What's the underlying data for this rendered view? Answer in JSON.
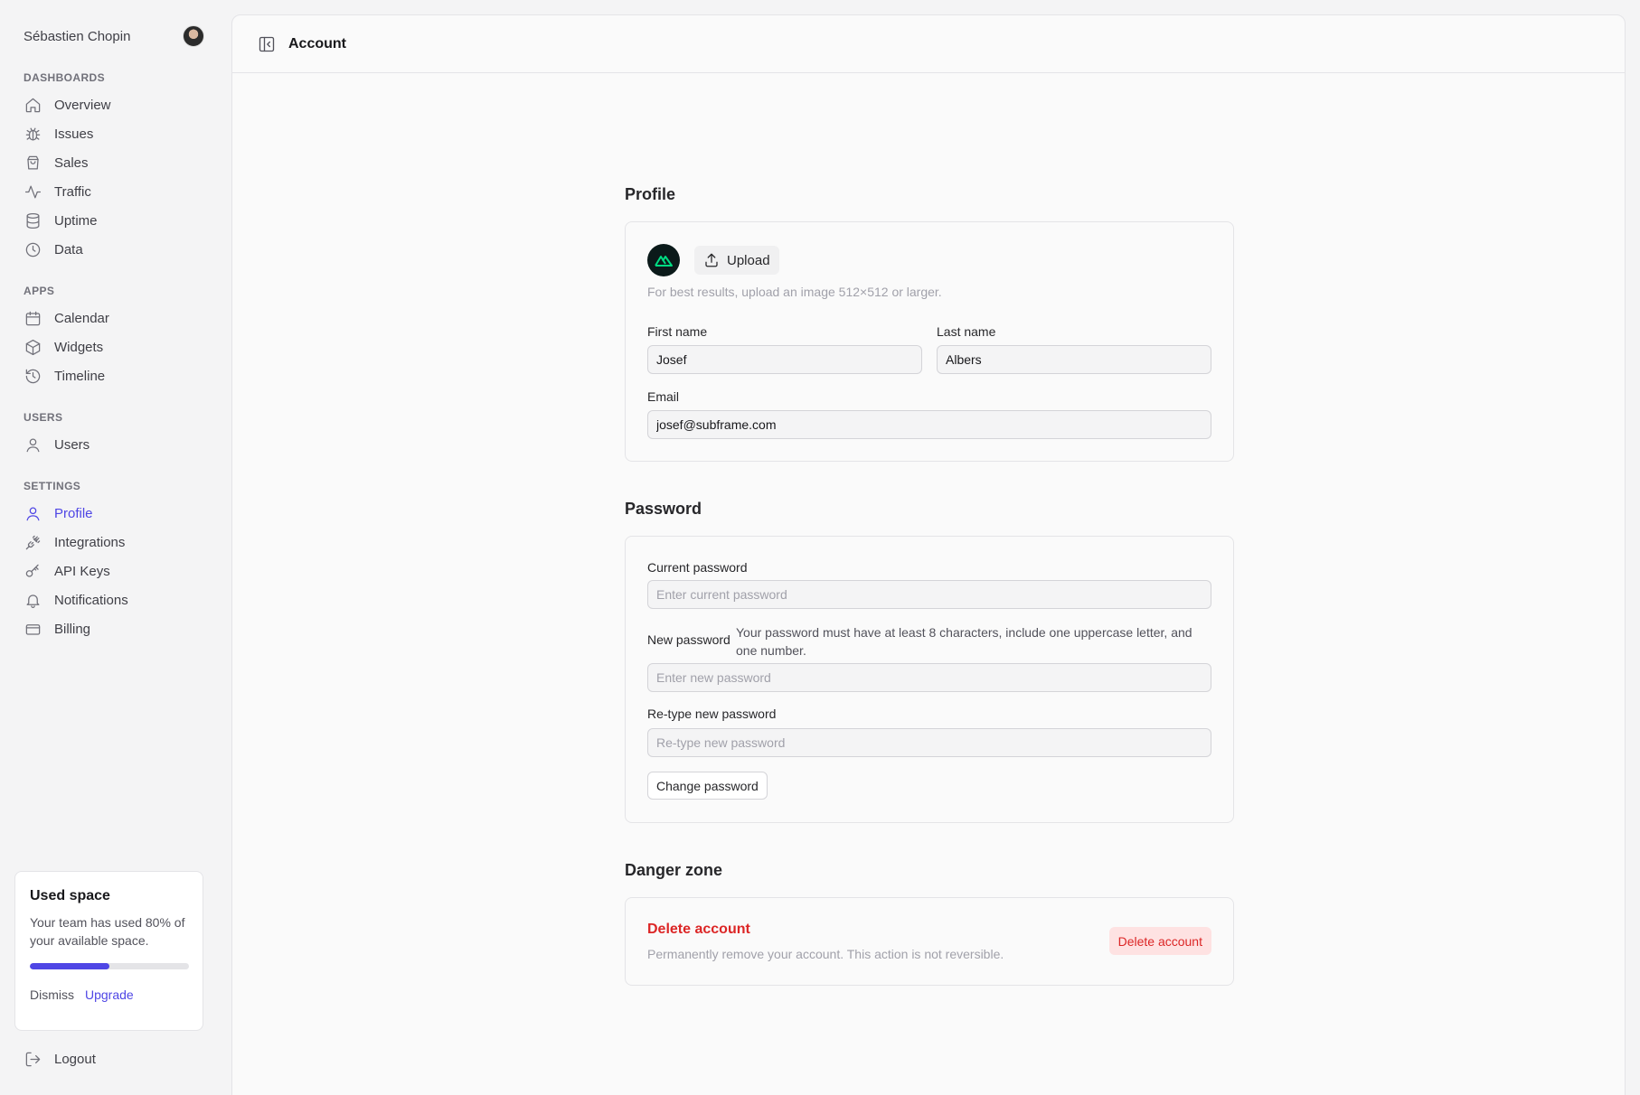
{
  "user": {
    "name": "Sébastien Chopin"
  },
  "sidebar": {
    "sections": [
      {
        "label": "DASHBOARDS",
        "items": [
          {
            "label": "Overview",
            "icon": "home-icon"
          },
          {
            "label": "Issues",
            "icon": "bug-icon"
          },
          {
            "label": "Sales",
            "icon": "shopping-bag-icon"
          },
          {
            "label": "Traffic",
            "icon": "activity-icon"
          },
          {
            "label": "Uptime",
            "icon": "database-icon"
          },
          {
            "label": "Data",
            "icon": "clock-icon"
          }
        ]
      },
      {
        "label": "APPS",
        "items": [
          {
            "label": "Calendar",
            "icon": "calendar-icon"
          },
          {
            "label": "Widgets",
            "icon": "cube-icon"
          },
          {
            "label": "Timeline",
            "icon": "history-icon"
          }
        ]
      },
      {
        "label": "USERS",
        "items": [
          {
            "label": "Users",
            "icon": "user-icon"
          }
        ]
      },
      {
        "label": "SETTINGS",
        "items": [
          {
            "label": "Profile",
            "icon": "user-icon",
            "active": true
          },
          {
            "label": "Integrations",
            "icon": "plug-icon"
          },
          {
            "label": "API Keys",
            "icon": "key-icon"
          },
          {
            "label": "Notifications",
            "icon": "bell-icon"
          },
          {
            "label": "Billing",
            "icon": "credit-card-icon"
          }
        ]
      }
    ],
    "used_space": {
      "title": "Used space",
      "text": "Your team has used 80% of your available space.",
      "progress_percent": 50,
      "dismiss": "Dismiss",
      "upgrade": "Upgrade"
    },
    "logout": "Logout"
  },
  "header": {
    "title": "Account"
  },
  "profile": {
    "heading": "Profile",
    "upload_label": "Upload",
    "hint": "For best results, upload an image 512×512 or larger.",
    "first_name_label": "First name",
    "first_name_value": "Josef",
    "last_name_label": "Last name",
    "last_name_value": "Albers",
    "email_label": "Email",
    "email_value": "josef@subframe.com"
  },
  "password": {
    "heading": "Password",
    "current_label": "Current password",
    "current_placeholder": "Enter current password",
    "new_label": "New password",
    "new_rule": "Your password must have at least 8 characters, include one uppercase letter, and one number.",
    "new_placeholder": "Enter new password",
    "retype_label": "Re-type new password",
    "retype_placeholder": "Re-type new password",
    "change_button": "Change password"
  },
  "danger": {
    "heading": "Danger zone",
    "title": "Delete account",
    "description": "Permanently remove your account. This action is not reversible.",
    "button": "Delete account"
  },
  "colors": {
    "accent": "#4f46e5",
    "danger": "#dc2626",
    "danger_bg": "#fee2e2"
  }
}
